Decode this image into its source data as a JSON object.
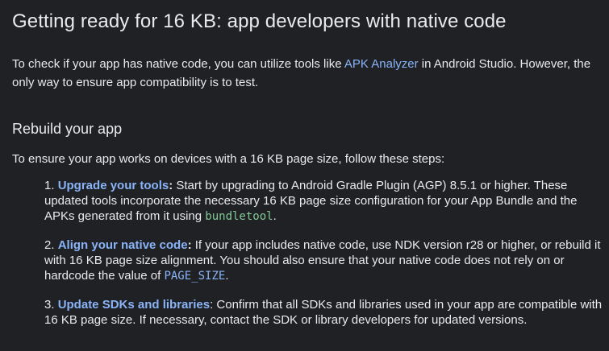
{
  "title": "Getting ready for 16 KB: app developers with native code",
  "intro": {
    "before_link": "To check if your app has native code, you can utilize tools like ",
    "link": "APK Analyzer",
    "after_link": " in Android Studio. However, the only way to ensure app compatibility is to test."
  },
  "section": {
    "heading": "Rebuild your app",
    "lead": "To ensure your app works on devices with a 16 KB page size, follow these steps:"
  },
  "steps": [
    {
      "number": "1.",
      "title": "Upgrade your tools",
      "colon": ":",
      "text_before_code": " Start by upgrading to Android Gradle Plugin (AGP) 8.5.1 or higher. These updated tools incorporate the necessary 16 KB page size configuration for your App Bundle and the APKs generated from it using ",
      "code": "bundletool",
      "text_after_code": "."
    },
    {
      "number": "2.",
      "title": "Align your native code",
      "colon": ":",
      "text_before_code": " If your app includes native code, use NDK version r28 or higher, or rebuild it with 16 KB page size alignment. You should also ensure that your native code does not rely on or hardcode the value of ",
      "code": "PAGE_SIZE",
      "text_after_code": "."
    },
    {
      "number": "3.",
      "title": "Update SDKs and libraries",
      "colon": "",
      "text_before_code": ": Confirm that all SDKs and libraries used in your app are compatible with 16 KB page size. If necessary, contact the SDK or library developers for updated versions.",
      "code": "",
      "text_after_code": ""
    }
  ],
  "colors": {
    "background": "#202124",
    "text": "#e8eaed",
    "link": "#8ab4f8",
    "code_green": "#81c995"
  }
}
